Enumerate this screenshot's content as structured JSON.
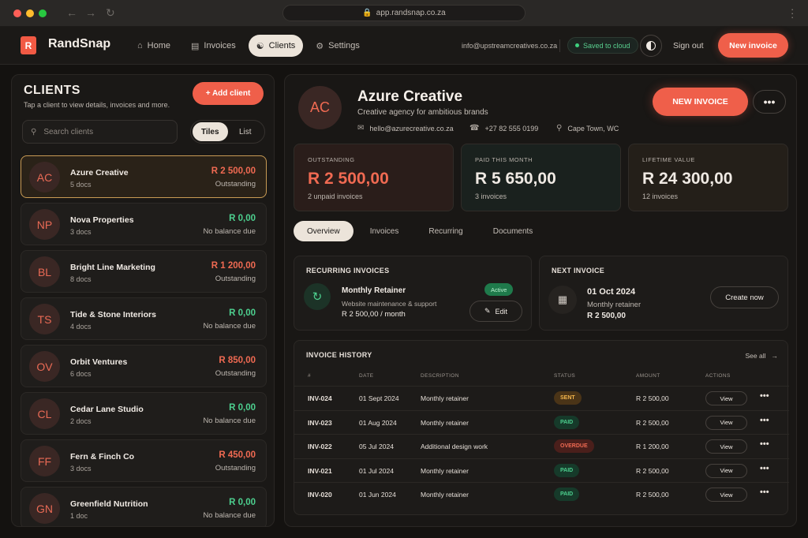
{
  "browser": {
    "url": "app.randsnap.co.za"
  },
  "header": {
    "logo_letter": "R",
    "brand": "RandSnap",
    "nav": [
      {
        "label": "Home",
        "icon": "home-icon"
      },
      {
        "label": "Invoices",
        "icon": "invoice-icon"
      },
      {
        "label": "Clients",
        "icon": "users-icon",
        "active": true
      },
      {
        "label": "Settings",
        "icon": "gear-icon"
      }
    ],
    "email": "info@upstreamcreatives.co.za",
    "saved": "Saved to cloud",
    "signout": "Sign out",
    "new_invoice": "New invoice"
  },
  "sidebar": {
    "title": "CLIENTS",
    "subtitle": "Tap a client to view details, invoices and more.",
    "add_label": "+ Add client",
    "search_placeholder": "Search clients",
    "view_tiles": "Tiles",
    "view_list": "List",
    "clients": [
      {
        "initials": "AC",
        "name": "Azure Creative",
        "docs": "5 docs",
        "amount": "R 2 500,00",
        "status": "Outstanding",
        "tone": "red",
        "selected": true
      },
      {
        "initials": "NP",
        "name": "Nova Properties",
        "docs": "3 docs",
        "amount": "R 0,00",
        "status": "No balance due",
        "tone": "green"
      },
      {
        "initials": "BL",
        "name": "Bright Line Marketing",
        "docs": "8 docs",
        "amount": "R 1 200,00",
        "status": "Outstanding",
        "tone": "red"
      },
      {
        "initials": "TS",
        "name": "Tide & Stone Interiors",
        "docs": "4 docs",
        "amount": "R 0,00",
        "status": "No balance due",
        "tone": "green"
      },
      {
        "initials": "OV",
        "name": "Orbit Ventures",
        "docs": "6 docs",
        "amount": "R 850,00",
        "status": "Outstanding",
        "tone": "red"
      },
      {
        "initials": "CL",
        "name": "Cedar Lane Studio",
        "docs": "2 docs",
        "amount": "R 0,00",
        "status": "No balance due",
        "tone": "green"
      },
      {
        "initials": "FF",
        "name": "Fern & Finch Co",
        "docs": "3 docs",
        "amount": "R 450,00",
        "status": "Outstanding",
        "tone": "red"
      },
      {
        "initials": "GN",
        "name": "Greenfield Nutrition",
        "docs": "1 doc",
        "amount": "R 0,00",
        "status": "No balance due",
        "tone": "green"
      }
    ]
  },
  "client": {
    "initials": "AC",
    "name": "Azure Creative",
    "tagline": "Creative agency for ambitious brands",
    "email": "hello@azurecreative.co.za",
    "phone": "+27 82 555 0199",
    "location": "Cape Town, WC",
    "new_invoice": "NEW INVOICE",
    "stats": [
      {
        "label": "OUTSTANDING",
        "value": "R 2 500,00",
        "note": "2 unpaid invoices"
      },
      {
        "label": "PAID THIS MONTH",
        "value": "R 5 650,00",
        "note": "3 invoices"
      },
      {
        "label": "LIFETIME VALUE",
        "value": "R 24 300,00",
        "note": "12 invoices"
      }
    ],
    "tabs": [
      "Overview",
      "Invoices",
      "Recurring",
      "Documents"
    ],
    "recurring": {
      "title": "RECURRING INVOICES",
      "name": "Monthly Retainer",
      "desc": "Website maintenance & support",
      "amount": "R 2 500,00 / month",
      "badge": "Active",
      "edit": "Edit"
    },
    "next": {
      "title": "NEXT INVOICE",
      "date": "01 Oct 2024",
      "label": "Monthly retainer",
      "amount": "R 2 500,00",
      "button": "Create now"
    },
    "history": {
      "title": "INVOICE HISTORY",
      "see_all": "See all",
      "columns": [
        "#",
        "DATE",
        "DESCRIPTION",
        "STATUS",
        "AMOUNT",
        "ACTIONS"
      ],
      "rows": [
        {
          "id": "INV-024",
          "date": "01 Sept 2024",
          "desc": "Monthly retainer",
          "status": "SENT",
          "amount": "R 2 500,00",
          "view": "View"
        },
        {
          "id": "INV-023",
          "date": "01 Aug 2024",
          "desc": "Monthly retainer",
          "status": "PAID",
          "amount": "R 2 500,00",
          "view": "View"
        },
        {
          "id": "INV-022",
          "date": "05 Jul 2024",
          "desc": "Additional design work",
          "status": "OVERDUE",
          "amount": "R 1 200,00",
          "view": "View"
        },
        {
          "id": "INV-021",
          "date": "01 Jul 2024",
          "desc": "Monthly retainer",
          "status": "PAID",
          "amount": "R 2 500,00",
          "view": "View"
        },
        {
          "id": "INV-020",
          "date": "01 Jun 2024",
          "desc": "Monthly retainer",
          "status": "PAID",
          "amount": "R 2 500,00",
          "view": "View"
        }
      ]
    }
  }
}
